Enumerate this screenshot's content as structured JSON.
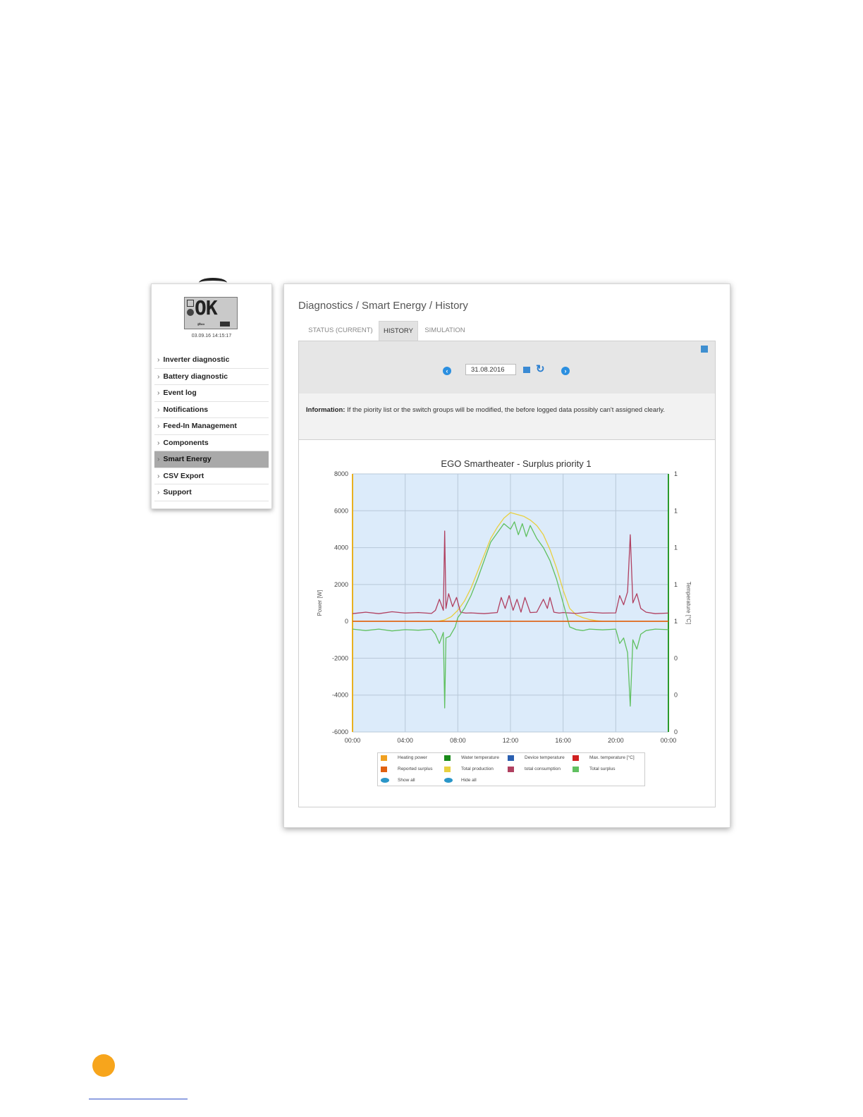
{
  "lcd": {
    "display": "OK",
    "timestamp": "03.09.16 14:15:17"
  },
  "sidebar": {
    "items": [
      {
        "label": "Inverter diagnostic",
        "active": false
      },
      {
        "label": "Battery diagnostic",
        "active": false
      },
      {
        "label": "Event log",
        "active": false
      },
      {
        "label": "Notifications",
        "active": false
      },
      {
        "label": "Feed-In Management",
        "active": false
      },
      {
        "label": "Components",
        "active": false
      },
      {
        "label": "Smart Energy",
        "active": true
      },
      {
        "label": "CSV Export",
        "active": false
      },
      {
        "label": "Support",
        "active": false
      }
    ]
  },
  "breadcrumb": "Diagnostics / Smart Energy / History",
  "tabs": [
    {
      "label": "STATUS (CURRENT)"
    },
    {
      "label": "HISTORY"
    },
    {
      "label": "SIMULATION"
    }
  ],
  "date_nav": {
    "date": "31.08.2016"
  },
  "info": {
    "label": "Information:",
    "text": "If the piority list or the switch groups will be modified, the before logged data possibly can't assigned clearly."
  },
  "chart_data": {
    "type": "line",
    "title": "EGO Smartheater - Surplus priority 1",
    "ylabel": "Power [W]",
    "y2label": "Temperature [°C]",
    "ylim": [
      -6000,
      8000
    ],
    "y_ticks": [
      "8000",
      "6000",
      "4000",
      "2000",
      "0",
      "-2000",
      "-4000",
      "-6000"
    ],
    "y2_ticks": [
      "1",
      "1",
      "1",
      "1",
      "1",
      "0",
      "0",
      "0"
    ],
    "x_ticks": [
      "00:00",
      "04:00",
      "08:00",
      "12:00",
      "16:00",
      "20:00",
      "00:00"
    ],
    "x_hours": [
      0,
      4,
      8,
      12,
      16,
      20,
      24
    ],
    "colors": {
      "heating_power": "#f0a020",
      "water_temperature": "#1a8a1a",
      "device_temperature": "#2a5fb0",
      "max_temperature": "#d02020",
      "reported_surplus": "#e06010",
      "total_production": "#e8d040",
      "total_consumption": "#b04060",
      "total_surplus": "#60c060",
      "plot_bg": "#dcebfa",
      "left_axis": "#e8b020",
      "right_axis": "#2a9a2a"
    },
    "series": [
      {
        "name": "Total production",
        "x": [
          0,
          6.5,
          7,
          7.5,
          8,
          8.5,
          9,
          9.5,
          10,
          10.5,
          11,
          11.5,
          12,
          12.5,
          13,
          13.5,
          14,
          14.5,
          15,
          15.5,
          16,
          16.5,
          17,
          17.5,
          18,
          18.5,
          19,
          19.5,
          24
        ],
        "y": [
          0,
          0,
          80,
          250,
          600,
          1100,
          1800,
          2700,
          3600,
          4500,
          5100,
          5600,
          5900,
          5800,
          5700,
          5500,
          5200,
          4700,
          3900,
          2900,
          1700,
          700,
          350,
          200,
          100,
          40,
          0,
          0,
          0
        ]
      },
      {
        "name": "total consumption",
        "x": [
          0,
          1,
          2,
          3,
          4,
          5,
          6,
          6.3,
          6.6,
          6.9,
          7.0,
          7.1,
          7.3,
          7.6,
          7.9,
          8.2,
          8.6,
          9,
          10,
          11,
          11.3,
          11.6,
          11.9,
          12.2,
          12.5,
          12.8,
          13.1,
          13.5,
          14,
          14.5,
          14.8,
          15,
          15.3,
          15.7,
          16,
          17,
          18,
          19,
          20,
          20.3,
          20.6,
          20.9,
          21.1,
          21.3,
          21.6,
          21.9,
          22.3,
          23,
          24
        ],
        "y": [
          420,
          500,
          420,
          520,
          450,
          480,
          430,
          600,
          1200,
          600,
          4900,
          700,
          1500,
          800,
          1300,
          500,
          450,
          460,
          420,
          480,
          1300,
          700,
          1400,
          600,
          1200,
          500,
          1300,
          480,
          500,
          1200,
          700,
          1300,
          500,
          450,
          480,
          430,
          500,
          450,
          460,
          1400,
          900,
          1600,
          4700,
          1000,
          1500,
          700,
          500,
          420,
          450
        ]
      },
      {
        "name": "Total surplus",
        "x": [
          0,
          1,
          2,
          3,
          4,
          5,
          6,
          6.3,
          6.6,
          6.9,
          7.0,
          7.1,
          7.4,
          7.8,
          8,
          8.5,
          9,
          9.5,
          10,
          10.5,
          11,
          11.5,
          12,
          12.3,
          12.6,
          12.9,
          13.2,
          13.5,
          14,
          14.5,
          15,
          15.5,
          16,
          16.5,
          17,
          17.5,
          18,
          19,
          20,
          20.3,
          20.6,
          20.9,
          21.1,
          21.3,
          21.6,
          21.9,
          22.3,
          23,
          24
        ],
        "y": [
          -420,
          -500,
          -420,
          -520,
          -450,
          -480,
          -430,
          -700,
          -1200,
          -600,
          -4700,
          -900,
          -800,
          -300,
          200,
          700,
          1400,
          2300,
          3300,
          4300,
          4800,
          5300,
          5000,
          5400,
          4700,
          5300,
          4600,
          5200,
          4500,
          4000,
          3300,
          2300,
          1000,
          -300,
          -450,
          -500,
          -420,
          -460,
          -420,
          -1200,
          -900,
          -1700,
          -4600,
          -1000,
          -1500,
          -700,
          -500,
          -420,
          -450
        ]
      },
      {
        "name": "Reported surplus",
        "x": [
          0,
          24
        ],
        "y": [
          0,
          0
        ]
      }
    ],
    "legend": [
      {
        "label": "Heating power",
        "color": "#f0a020"
      },
      {
        "label": "Water temperature",
        "color": "#1a8a1a"
      },
      {
        "label": "Device temperature",
        "color": "#2a5fb0"
      },
      {
        "label": "Max. temperature [°C]",
        "color": "#d02020"
      },
      {
        "label": "Reported surplus",
        "color": "#e06010"
      },
      {
        "label": "Total production",
        "color": "#e8d040"
      },
      {
        "label": "total consumption",
        "color": "#b04060"
      },
      {
        "label": "Total surplus",
        "color": "#60c060"
      }
    ],
    "legend_actions": [
      {
        "label": "Show all"
      },
      {
        "label": "Hide all"
      }
    ]
  }
}
